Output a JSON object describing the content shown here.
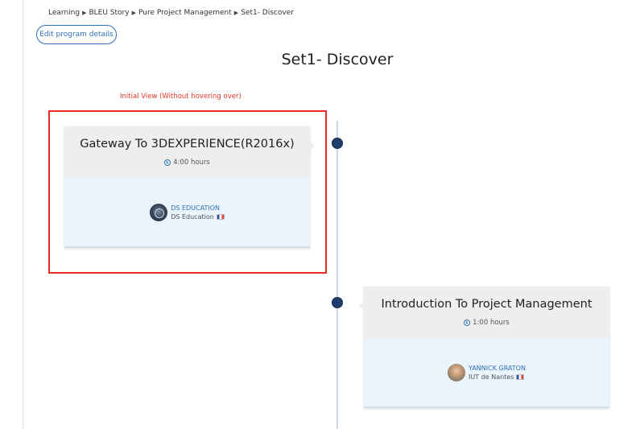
{
  "breadcrumb": {
    "items": [
      "Learning",
      "BLEU Story",
      "Pure Project Management",
      "Set1- Discover"
    ],
    "separator": "▶"
  },
  "header": {
    "edit_button_label": "Edit program details",
    "title": "Set1- Discover"
  },
  "annotation": {
    "text": "Initial View (Without hovering over)",
    "color": "#e53225"
  },
  "courses": [
    {
      "title": "Gateway To 3DEXPERIENCE(R2016x)",
      "duration": "4:00 hours",
      "instructor_name": "DS EDUCATION",
      "instructor_org": "DS Education",
      "avatar": "ds-logo-icon"
    },
    {
      "title": "Introduction To Project Management",
      "duration": "1:00 hours",
      "instructor_name": "YANNICK GRATON",
      "instructor_org": "IUT de Nantes",
      "avatar": "person-photo"
    }
  ],
  "colors": {
    "accent": "#2f6fb4",
    "timeline_dot": "#1e3f6e",
    "card_head_bg": "#eeeeee",
    "card_body_bg": "#eaf4fc"
  }
}
